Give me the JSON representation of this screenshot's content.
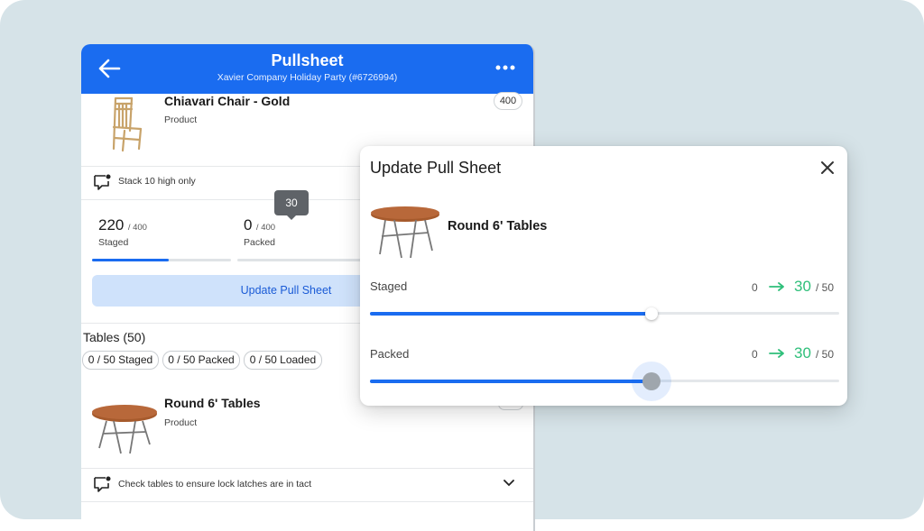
{
  "header": {
    "title": "Pullsheet",
    "subtitle": "Xavier Company Holiday Party (#6726994)"
  },
  "product1": {
    "name": "Chiavari Chair - Gold",
    "type": "Product",
    "quantity": "400",
    "note": "Stack 10 high only",
    "staged": {
      "count": "220",
      "total": "/ 400",
      "label": "Staged",
      "fraction": 0.55
    },
    "packed": {
      "count": "0",
      "total": "/ 400",
      "label": "Packed",
      "fraction": 0
    },
    "update_button": "Update Pull Sheet"
  },
  "tables_section": {
    "title": "Tables (50)",
    "chips": [
      "0 / 50 Staged",
      "0 / 50 Packed",
      "0 / 50 Loaded"
    ]
  },
  "product2": {
    "name": "Round 6' Tables",
    "type": "Product",
    "note": "Check tables to ensure lock latches are in tact"
  },
  "modal": {
    "title": "Update Pull Sheet",
    "product_name": "Round 6' Tables",
    "staged": {
      "label": "Staged",
      "from": "0",
      "to": "30",
      "max": "/ 50",
      "value": 30,
      "limit": 50
    },
    "packed": {
      "label": "Packed",
      "from": "0",
      "to": "30",
      "max": "/ 50",
      "value": 30,
      "limit": 50,
      "tooltip": "30"
    }
  },
  "colors": {
    "brand": "#1a6cf0",
    "accent_green": "#2fbf7a",
    "background": "#d6e3e8"
  },
  "icons": {
    "back": "arrow-left-icon",
    "more": "more-horizontal-icon",
    "note": "comment-note-icon",
    "close": "close-icon",
    "expand": "chevron-down-icon"
  }
}
